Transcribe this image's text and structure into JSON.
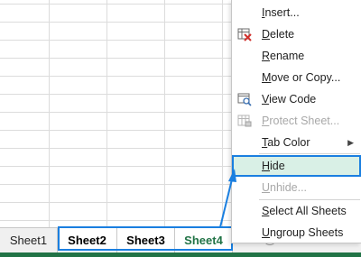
{
  "sheet_tabs": [
    {
      "label": "Sheet1"
    },
    {
      "label": "Sheet2"
    },
    {
      "label": "Sheet3"
    },
    {
      "label": "Sheet4"
    }
  ],
  "context_menu": {
    "insert": {
      "underline": "I",
      "rest": "nsert..."
    },
    "delete": {
      "underline": "D",
      "rest": "elete"
    },
    "rename": {
      "underline": "R",
      "rest": "ename"
    },
    "move_copy": {
      "underline": "M",
      "rest": "ove or Copy..."
    },
    "view_code": {
      "underline": "V",
      "rest": "iew Code"
    },
    "protect_sheet": {
      "underline": "P",
      "rest": "rotect Sheet..."
    },
    "tab_color": {
      "underline": "T",
      "rest": "ab Color"
    },
    "hide": {
      "underline": "H",
      "rest": "ide"
    },
    "unhide": {
      "underline": "U",
      "rest": "nhide..."
    },
    "select_all": {
      "underline": "S",
      "rest": "elect All Sheets"
    },
    "ungroup": {
      "underline": "U",
      "rest": "ngroup Sheets"
    }
  },
  "colors": {
    "excel_green": "#217346",
    "highlight_fill": "#d9f0e6",
    "callout_blue": "#1a7fe0",
    "disabled_text": "#a8a8a8"
  },
  "icons": {
    "delete": "delete-sheet-icon",
    "view_code": "view-code-icon",
    "protect": "protect-sheet-icon",
    "submenu": "chevron-right-icon",
    "add": "add-sheet-icon"
  }
}
